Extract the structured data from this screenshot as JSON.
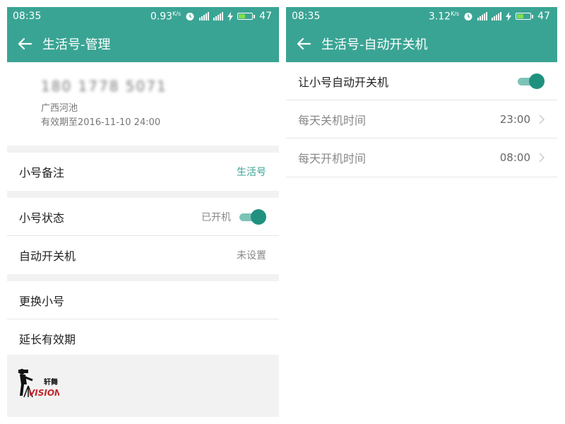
{
  "left": {
    "status": {
      "time": "08:35",
      "speed": "0.93",
      "speed_unit": "K/s",
      "battery": "47"
    },
    "appbar": {
      "title": "生活号-管理"
    },
    "profile": {
      "number": "180 1778 5071",
      "location": "广西河池",
      "expiry": "有效期至2016-11-10 24:00"
    },
    "rows": {
      "remark": {
        "label": "小号备注",
        "value": "生活号"
      },
      "state": {
        "label": "小号状态",
        "value": "已开机",
        "toggle_on": true
      },
      "auto": {
        "label": "自动开关机",
        "value": "未设置"
      },
      "replace": {
        "label": "更换小号"
      },
      "extend": {
        "label": "延长有效期"
      }
    },
    "logo": {
      "text_top": "轩舞",
      "text_bottom": "VISION"
    }
  },
  "right": {
    "status": {
      "time": "08:35",
      "speed": "3.12",
      "speed_unit": "K/s",
      "battery": "47"
    },
    "appbar": {
      "title": "生活号-自动开关机"
    },
    "rows": {
      "auto_toggle": {
        "label": "让小号自动开关机",
        "toggle_on": true
      },
      "off_time": {
        "label": "每天关机时间",
        "value": "23:00"
      },
      "on_time": {
        "label": "每天开机时间",
        "value": "08:00"
      }
    }
  },
  "colors": {
    "accent": "#3aa494",
    "toggle_knob": "#20917f",
    "background": "#f2f2f2"
  }
}
